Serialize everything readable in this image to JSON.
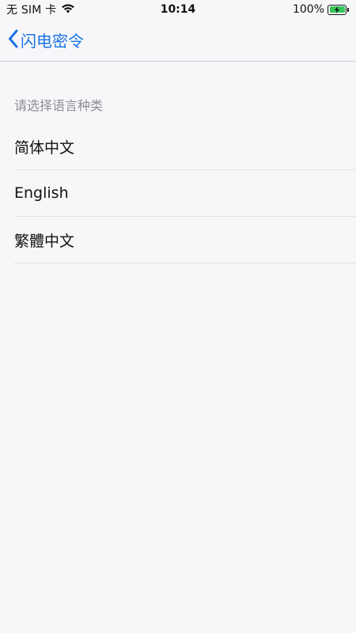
{
  "status_bar": {
    "carrier": "无 SIM 卡",
    "time": "10:14",
    "battery_percent": "100%",
    "battery_level": 1.0
  },
  "nav": {
    "back_label": "闪电密令"
  },
  "section": {
    "header": "请选择语言种类"
  },
  "languages": [
    {
      "label": "简体中文"
    },
    {
      "label": "English"
    },
    {
      "label": "繁體中文"
    }
  ],
  "colors": {
    "accent": "#1a73e8",
    "background": "#f7f7f9",
    "battery": "#34c759",
    "section_header": "#8e8e93"
  }
}
